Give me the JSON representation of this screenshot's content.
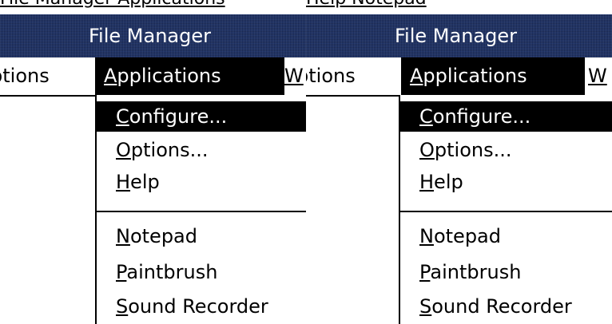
{
  "window": {
    "title": "File Manager",
    "top_fragment_left": "File Manager  Applications",
    "top_fragment_right": "Help  Notepad"
  },
  "menubar": {
    "options_fragment": "ptions",
    "applications_label": "Applications",
    "applications_mnemonic": "A",
    "applications_rest": "pplications",
    "window_fragment": "W"
  },
  "applications_menu": {
    "items": [
      {
        "mnemonic": "C",
        "rest": "onfigure...",
        "highlighted": true
      },
      {
        "mnemonic": "O",
        "rest": "ptions..."
      },
      {
        "mnemonic": "H",
        "rest": "elp"
      },
      {
        "mnemonic": "N",
        "rest": "otepad"
      },
      {
        "mnemonic": "P",
        "rest": "aintbrush"
      },
      {
        "mnemonic": "S",
        "rest": "ound Recorder"
      }
    ]
  }
}
